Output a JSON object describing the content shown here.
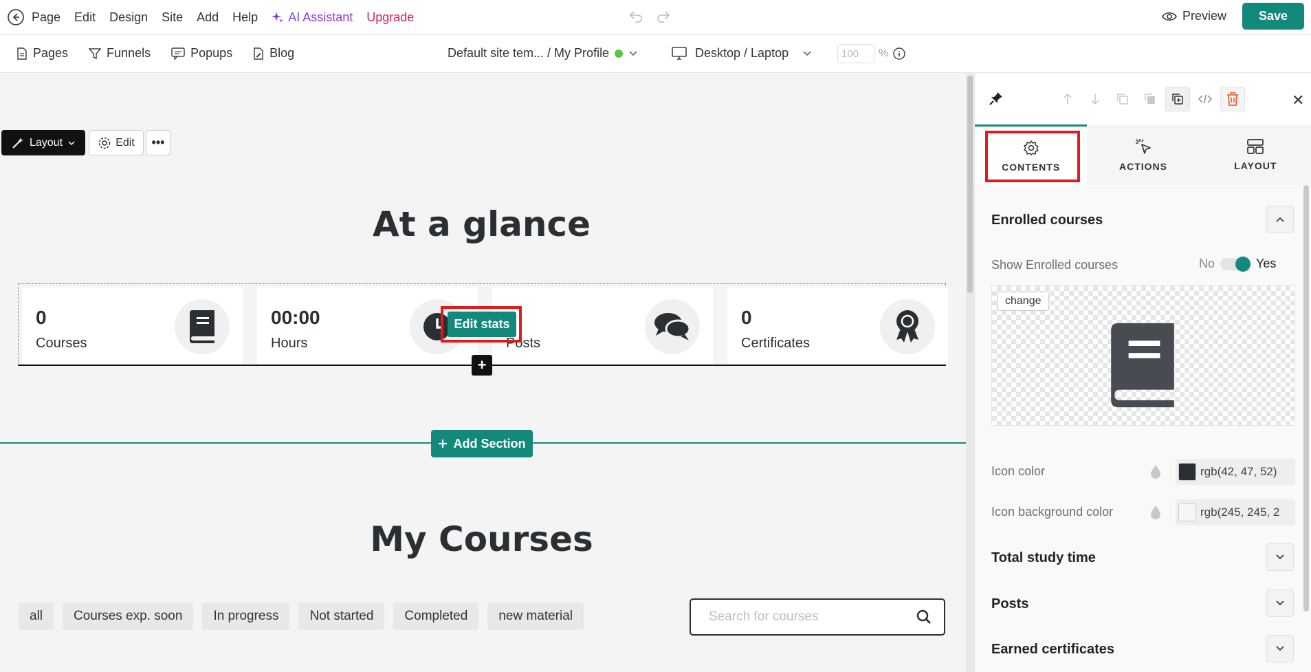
{
  "topbar": {
    "menu": [
      "Page",
      "Edit",
      "Design",
      "Site",
      "Add",
      "Help"
    ],
    "ai_label": "AI Assistant",
    "upgrade_label": "Upgrade",
    "preview_label": "Preview",
    "save_label": "Save"
  },
  "subbar": {
    "nav": [
      "Pages",
      "Funnels",
      "Popups",
      "Blog"
    ],
    "template_label": "Default site tem... / My Profile",
    "device_label": "Desktop / Laptop",
    "zoom_value": "100",
    "zoom_unit": "%"
  },
  "canvas": {
    "layout_btn": "Layout",
    "edit_btn": "Edit",
    "more_btn": "•••",
    "glance_title": "At a glance",
    "stats": [
      {
        "value": "0",
        "label": "Courses",
        "icon": "book-icon"
      },
      {
        "value": "00:00",
        "label": "Hours",
        "icon": "clock-icon"
      },
      {
        "value": "",
        "label": "Posts",
        "icon": "chat-icon"
      },
      {
        "value": "0",
        "label": "Certificates",
        "icon": "award-icon"
      }
    ],
    "edit_stats_label": "Edit stats",
    "plus_label": "+",
    "add_section_label": "Add Section",
    "courses_title": "My Courses",
    "filters": [
      "all",
      "Courses exp. soon",
      "In progress",
      "Not started",
      "Completed",
      "new material"
    ],
    "search_placeholder": "Search for courses"
  },
  "panel": {
    "tabs": [
      "CONTENTS",
      "ACTIONS",
      "LAYOUT"
    ],
    "section_enrolled": "Enrolled courses",
    "show_enrolled_label": "Show Enrolled courses",
    "toggle_no": "No",
    "toggle_yes": "Yes",
    "change_label": "change",
    "icon_color_label": "Icon color",
    "icon_color_value": "rgb(42, 47, 52)",
    "icon_bg_label": "Icon background color",
    "icon_bg_value": "rgb(245, 245, 2",
    "sections": [
      "Total study time",
      "Posts",
      "Earned certificates"
    ]
  },
  "colors": {
    "accent": "#13897c",
    "highlight": "#e01b1b",
    "icon_color": "#2a2f34",
    "icon_bg": "#f5f5f5",
    "ai": "#8b3fd9",
    "upgrade": "#d4215e"
  }
}
